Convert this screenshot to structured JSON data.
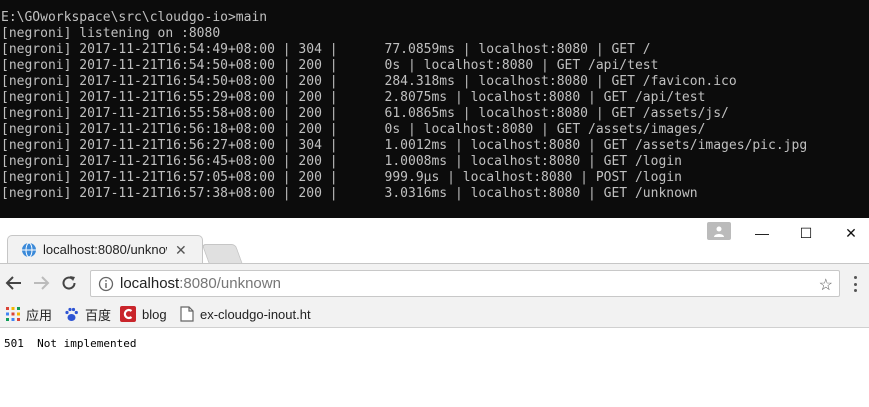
{
  "terminal": {
    "lines": [
      "E:\\GOworkspace\\src\\cloudgo-io>main",
      "[negroni] listening on :8080",
      "[negroni] 2017-11-21T16:54:49+08:00 | 304 |      77.0859ms | localhost:8080 | GET /",
      "[negroni] 2017-11-21T16:54:50+08:00 | 200 |      0s | localhost:8080 | GET /api/test",
      "[negroni] 2017-11-21T16:54:50+08:00 | 200 |      284.318ms | localhost:8080 | GET /favicon.ico",
      "[negroni] 2017-11-21T16:55:29+08:00 | 200 |      2.8075ms | localhost:8080 | GET /api/test",
      "[negroni] 2017-11-21T16:55:58+08:00 | 200 |      61.0865ms | localhost:8080 | GET /assets/js/",
      "[negroni] 2017-11-21T16:56:18+08:00 | 200 |      0s | localhost:8080 | GET /assets/images/",
      "[negroni] 2017-11-21T16:56:27+08:00 | 304 |      1.0012ms | localhost:8080 | GET /assets/images/pic.jpg",
      "[negroni] 2017-11-21T16:56:45+08:00 | 200 |      1.0008ms | localhost:8080 | GET /login",
      "[negroni] 2017-11-21T16:57:05+08:00 | 200 |      999.9µs | localhost:8080 | POST /login",
      "[negroni] 2017-11-21T16:57:38+08:00 | 200 |      3.0316ms | localhost:8080 | GET /unknown"
    ]
  },
  "browser": {
    "tab": {
      "title": "localhost:8080/unknow",
      "favicon": "globe-icon"
    },
    "window_controls": {
      "minimize": "—",
      "maximize": "☐",
      "close": "✕"
    },
    "address": {
      "host": "localhost",
      "rest": ":8080/unknown"
    },
    "bookmarks": [
      {
        "label": "应用",
        "icon": "apps-grid-icon"
      },
      {
        "label": "百度",
        "icon": "baidu-paw-icon"
      },
      {
        "label": "blog",
        "icon": "blog-c-icon"
      },
      {
        "label": "ex-cloudgo-inout.ht",
        "icon": "page-icon"
      }
    ],
    "page_text": "501  Not implemented"
  },
  "colors": {
    "terminal_bg": "#0c0c0c",
    "terminal_fg": "#c0c0c0",
    "chrome_toolbar": "#f2f2f2"
  }
}
